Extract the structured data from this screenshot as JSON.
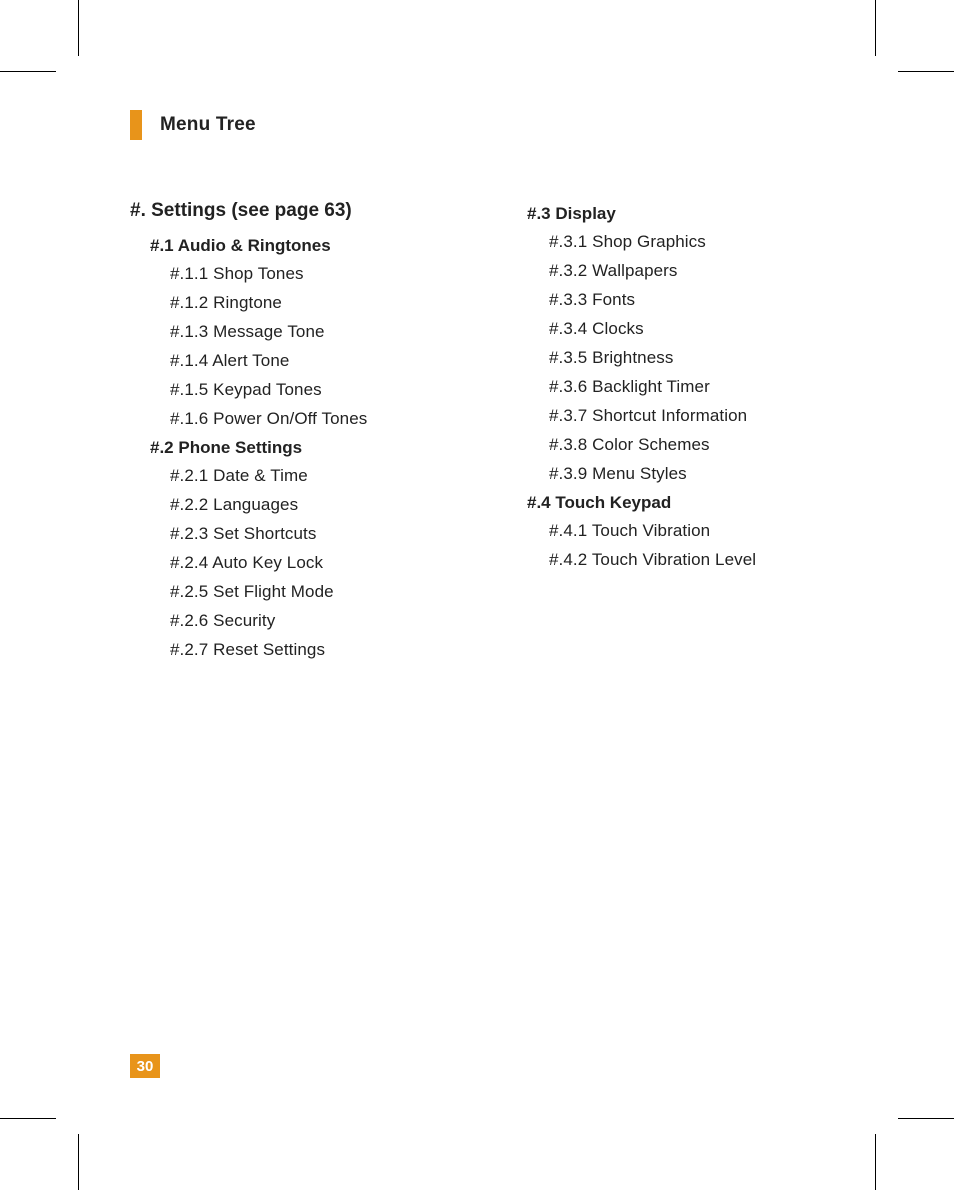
{
  "header": {
    "title": "Menu Tree"
  },
  "pageNumber": "30",
  "left": {
    "section": "#. Settings (see page 63)",
    "subsections": [
      {
        "title": "#.1 Audio & Ringtones",
        "items": [
          "#.1.1 Shop Tones",
          "#.1.2 Ringtone",
          "#.1.3 Message Tone",
          "#.1.4 Alert Tone",
          "#.1.5 Keypad Tones",
          "#.1.6 Power On/Off Tones"
        ]
      },
      {
        "title": "#.2 Phone Settings",
        "items": [
          "#.2.1 Date & Time",
          "#.2.2 Languages",
          "#.2.3 Set Shortcuts",
          "#.2.4 Auto Key Lock",
          "#.2.5 Set Flight Mode",
          "#.2.6 Security",
          "#.2.7 Reset Settings"
        ]
      }
    ]
  },
  "right": {
    "subsections": [
      {
        "title": "#.3 Display",
        "items": [
          "#.3.1 Shop Graphics",
          "#.3.2 Wallpapers",
          "#.3.3 Fonts",
          "#.3.4 Clocks",
          "#.3.5 Brightness",
          "#.3.6 Backlight Timer",
          "#.3.7 Shortcut Information",
          "#.3.8 Color Schemes",
          "#.3.9 Menu Styles"
        ]
      },
      {
        "title": "#.4 Touch Keypad",
        "items": [
          "#.4.1 Touch Vibration",
          "#.4.2 Touch Vibration Level"
        ]
      }
    ]
  }
}
